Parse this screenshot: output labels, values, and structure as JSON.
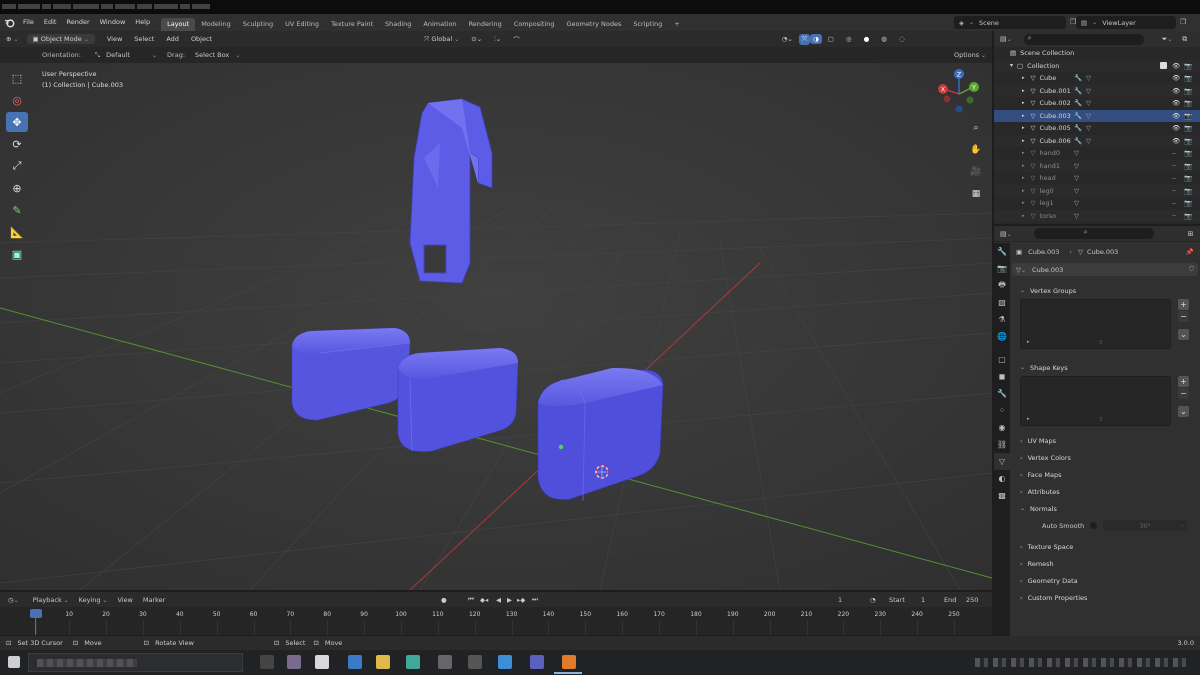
{
  "menu": {
    "items": [
      "File",
      "Edit",
      "Render",
      "Window",
      "Help"
    ],
    "workspaces": [
      "Layout",
      "Modeling",
      "Sculpting",
      "UV Editing",
      "Texture Paint",
      "Shading",
      "Animation",
      "Rendering",
      "Compositing",
      "Geometry Nodes",
      "Scripting"
    ],
    "active_workspace": "Layout",
    "add_tab": "+"
  },
  "scene": {
    "label": "Scene",
    "view_layer": "ViewLayer"
  },
  "viewport_header": {
    "mode": "Object Mode",
    "menus": [
      "View",
      "Select",
      "Add",
      "Object"
    ],
    "transform_orientation": "Global"
  },
  "tool_settings": {
    "orientation_label": "Orientation:",
    "orientation_value": "Default",
    "drag_label": "Drag:",
    "drag_value": "Select Box",
    "options_label": "Options"
  },
  "viewport": {
    "perspective": "User Perspective",
    "context": "(1) Collection | Cube.003",
    "gizmo_axes": [
      "X",
      "Y",
      "Z"
    ]
  },
  "outliner": {
    "root": "Scene Collection",
    "collection": "Collection",
    "items": [
      {
        "name": "Cube",
        "dim": false,
        "selected": false
      },
      {
        "name": "Cube.001",
        "dim": false,
        "selected": false
      },
      {
        "name": "Cube.002",
        "dim": false,
        "selected": false
      },
      {
        "name": "Cube.003",
        "dim": false,
        "selected": true
      },
      {
        "name": "Cube.005",
        "dim": false,
        "selected": false
      },
      {
        "name": "Cube.006",
        "dim": false,
        "selected": false
      },
      {
        "name": "hand0",
        "dim": true,
        "selected": false
      },
      {
        "name": "hand1",
        "dim": true,
        "selected": false
      },
      {
        "name": "head",
        "dim": true,
        "selected": false
      },
      {
        "name": "leg0",
        "dim": true,
        "selected": false
      },
      {
        "name": "leg1",
        "dim": true,
        "selected": false
      },
      {
        "name": "torso",
        "dim": true,
        "selected": false
      }
    ]
  },
  "properties": {
    "breadcrumb_object": "Cube.003",
    "breadcrumb_data": "Cube.003",
    "mesh_name": "Cube.003",
    "panels": {
      "vertex_groups": "Vertex Groups",
      "shape_keys": "Shape Keys",
      "uv_maps": "UV Maps",
      "vertex_colors": "Vertex Colors",
      "face_maps": "Face Maps",
      "attributes": "Attributes",
      "normals": "Normals",
      "auto_smooth": "Auto Smooth",
      "auto_smooth_angle": "30°",
      "texture_space": "Texture Space",
      "remesh": "Remesh",
      "geometry_data": "Geometry Data",
      "custom_properties": "Custom Properties"
    }
  },
  "timeline": {
    "menus": [
      "Playback",
      "Keying",
      "View",
      "Marker"
    ],
    "current_frame": "1",
    "start_label": "Start",
    "start": "1",
    "end_label": "End",
    "end": "250",
    "ticks": [
      "1",
      "10",
      "20",
      "30",
      "40",
      "50",
      "60",
      "70",
      "80",
      "90",
      "100",
      "110",
      "120",
      "130",
      "140",
      "150",
      "160",
      "170",
      "180",
      "190",
      "200",
      "210",
      "220",
      "230",
      "240",
      "250"
    ]
  },
  "statusbar": {
    "hints": [
      "Set 3D Cursor",
      "Move",
      "Rotate View",
      "Select",
      "Move"
    ],
    "version": "3.0.0"
  },
  "colors": {
    "mesh": "#5c5ce6",
    "selected": "#4772b3",
    "x_axis": "#c83a3a",
    "y_axis": "#5aa832",
    "z_axis": "#3a6ec8"
  }
}
